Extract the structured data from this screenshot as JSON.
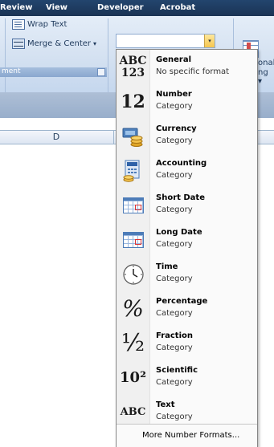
{
  "ribbon_tabs": [
    "Review",
    "View",
    "Developer",
    "Acrobat"
  ],
  "ribbon": {
    "wrap_text": "Wrap Text",
    "merge_center": "Merge & Center",
    "merge_arrow": "▾",
    "group_label_alignment": "ment",
    "side_text_1": "onal",
    "side_text_2": "ng ▾"
  },
  "number_format_combo": {
    "value": "",
    "arrow": "▾"
  },
  "column_header": {
    "label": "D"
  },
  "colors": {
    "tab_bar": "#1f3e64",
    "ribbon_bg": "#d4e1f1",
    "dropdown_bg": "#fafafa"
  },
  "formats": [
    {
      "title": "General",
      "subtitle": "No specific format",
      "icon": "abc-123-icon",
      "glyph": "ABC",
      "glyph2": "123"
    },
    {
      "title": "Number",
      "subtitle": "Category",
      "icon": "number-12-icon",
      "glyph": "12"
    },
    {
      "title": "Currency",
      "subtitle": "Category",
      "icon": "currency-icon"
    },
    {
      "title": "Accounting",
      "subtitle": "Category",
      "icon": "accounting-icon"
    },
    {
      "title": "Short Date",
      "subtitle": "Category",
      "icon": "calendar-icon"
    },
    {
      "title": "Long Date",
      "subtitle": "Category",
      "icon": "calendar-icon"
    },
    {
      "title": "Time",
      "subtitle": "Category",
      "icon": "clock-icon"
    },
    {
      "title": "Percentage",
      "subtitle": "Category",
      "icon": "percent-icon",
      "glyph": "%"
    },
    {
      "title": "Fraction",
      "subtitle": "Category",
      "icon": "fraction-icon",
      "glyph": "½"
    },
    {
      "title": "Scientific",
      "subtitle": "Category",
      "icon": "scientific-icon",
      "glyph": "10²"
    },
    {
      "title": "Text",
      "subtitle": "Category",
      "icon": "text-abc-icon",
      "glyph": "ABC"
    }
  ],
  "footer": {
    "more_formats": "More Number Formats..."
  }
}
